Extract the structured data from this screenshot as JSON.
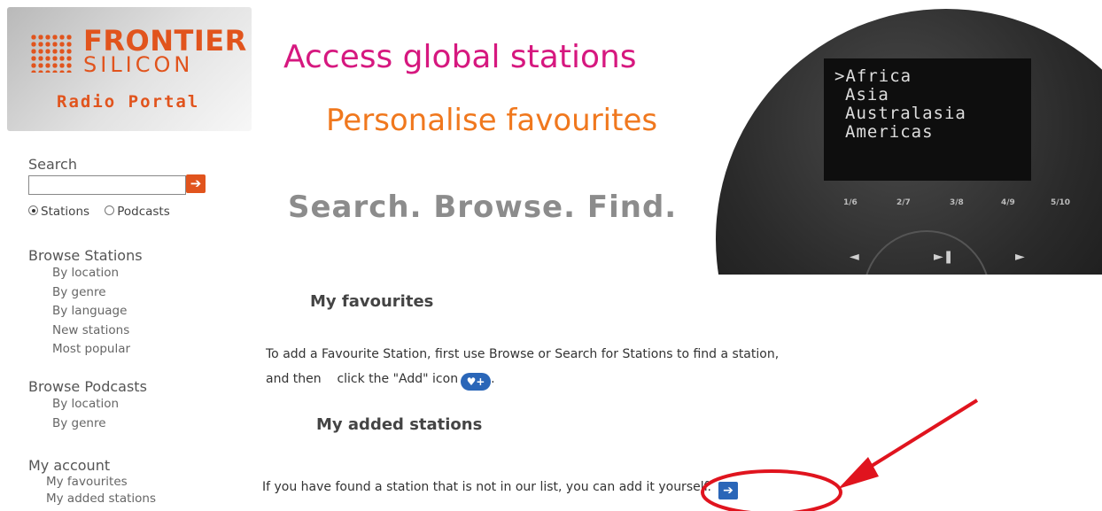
{
  "logo": {
    "brand_line1": "FRONTIER",
    "brand_line2": "SILICON",
    "subtitle": "Radio Portal"
  },
  "banner": {
    "headline1": "Access global stations",
    "headline2": "Personalise favourites",
    "tagline": "Search. Browse. Find.",
    "device_screen": [
      "Africa",
      "Asia",
      "Australasia",
      "Americas"
    ],
    "cursor": ">",
    "preset_buttons": [
      "1/6",
      "2/7",
      "3/8",
      "4/9",
      "5/10"
    ],
    "nav_arrows": [
      "◄",
      "►❚",
      "►"
    ]
  },
  "sidebar": {
    "search_label": "Search",
    "search_go": "➔",
    "radio_stations": "Stations",
    "radio_podcasts": "Podcasts",
    "browse_stations": {
      "title": "Browse Stations",
      "items": [
        "By location",
        "By genre",
        "By language",
        "New stations",
        "Most popular"
      ]
    },
    "browse_podcasts": {
      "title": "Browse Podcasts",
      "items": [
        "By location",
        "By genre"
      ]
    },
    "my_account": {
      "title": "My account",
      "items": [
        "My favourites",
        "My added stations"
      ]
    }
  },
  "main": {
    "favourites_title": "My favourites",
    "favourites_text1": "To add a Favourite Station, first use Browse or Search for Stations to find a station,",
    "favourites_text2_a": "and then",
    "favourites_text2_b": "click the \"Add\" icon",
    "favourites_icon": "♥+",
    "favourites_text2_c": ".",
    "added_title": "My added stations",
    "added_text": "If you have found a station that is not in our list, you can add it yourself.",
    "added_go": "➔"
  },
  "annotation_color": "#e0141e"
}
